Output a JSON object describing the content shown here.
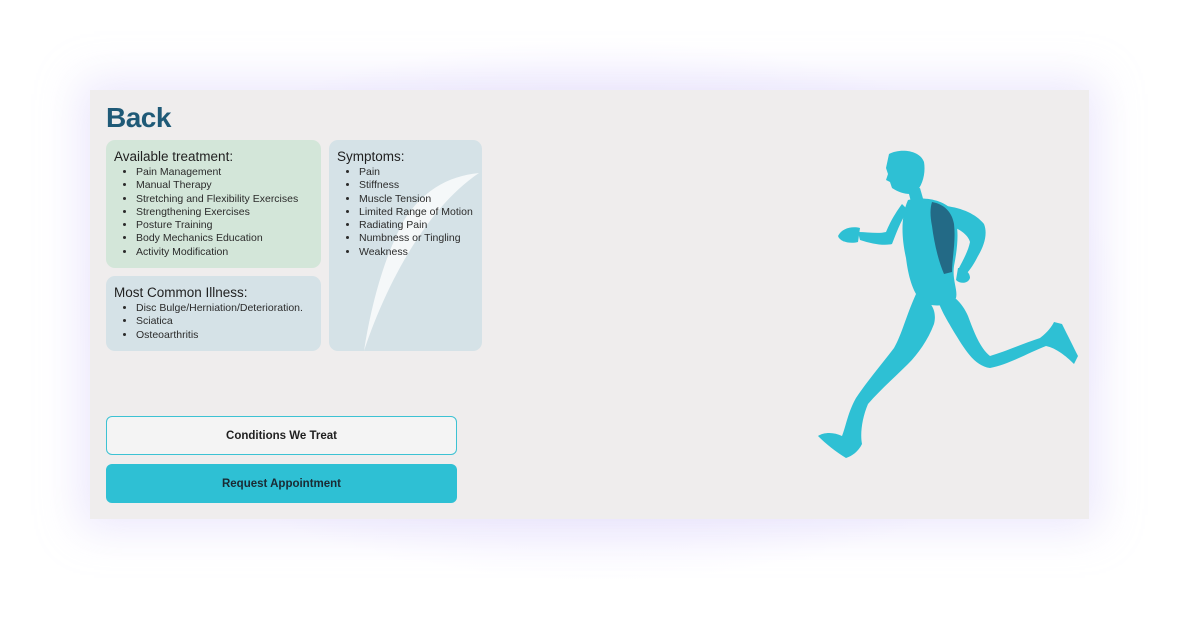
{
  "page": {
    "title": "Back"
  },
  "treatment": {
    "heading": "Available treatment:",
    "items": [
      "Pain Management",
      "Manual Therapy",
      "Stretching and Flexibility Exercises",
      "Strengthening Exercises",
      "Posture Training",
      "Body Mechanics Education",
      "Activity Modification"
    ]
  },
  "illness": {
    "heading": "Most Common Illness:",
    "items": [
      "Disc Bulge/Herniation/Deterioration.",
      "Sciatica",
      "Osteoarthritis"
    ]
  },
  "symptoms": {
    "heading": "Symptoms:",
    "items": [
      "Pain",
      "Stiffness",
      "Muscle Tension",
      "Limited Range of Motion",
      "Radiating Pain",
      "Numbness or Tingling",
      "Weakness"
    ]
  },
  "actions": {
    "conditions_label": "Conditions We Treat",
    "appointment_label": "Request Appointment"
  },
  "illustration": {
    "icon": "running-man-back-highlight",
    "body_color": "#2ec0d4",
    "highlight_color": "#236a86"
  },
  "colors": {
    "title": "#1f5a77",
    "accent": "#2ec0d4",
    "treatment_panel": "#d3e6d9",
    "info_panel": "#d5e2e7",
    "card_background": "#efeded"
  }
}
